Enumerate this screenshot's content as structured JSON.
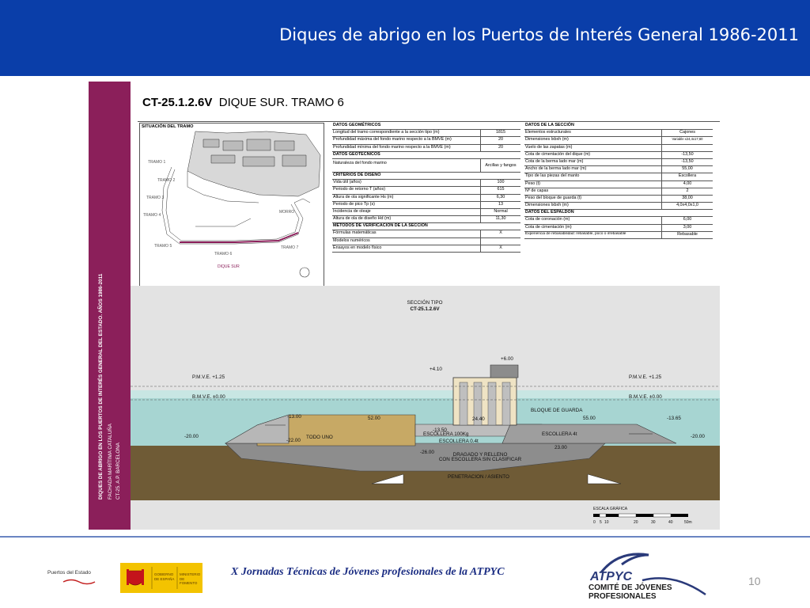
{
  "header": {
    "title": "Diques de abrigo en los Puertos de Interés General  1986-2011"
  },
  "sheet": {
    "code": "CT-25.1.2.6V",
    "name": "DIQUE SUR. TRAMO 6",
    "band_lines": [
      "DIQUES DE ABRIGO EN LOS PUERTOS DE INTERÉS GENERAL DEL ESTADO. AÑOS 1986-2011",
      "FACHADA MARÍTIMA CATALUÑA",
      "CT-25. A.P. BARCELONA"
    ],
    "situacion": {
      "title": "SITUACIÓN DEL TRAMO",
      "labels": [
        "TRAMO 1",
        "TRAMO 2",
        "TRAMO 3",
        "TRAMO 4",
        "TRAMO 5",
        "TRAMO 6",
        "TRAMO 7",
        "MORRO",
        "DIQUE SUR"
      ]
    },
    "geo": {
      "title": "DATOS GEOMÉTRICOS",
      "rows": [
        {
          "k": "Longitud del tramo correspondiente a la sección tipo (m)",
          "v": "1815"
        },
        {
          "k": "Profundidad máxima del fondo marino respecto a la BMVE (m)",
          "v": "20"
        },
        {
          "k": "Profundidad mínima del fondo marino respecto a la BMVE (m)",
          "v": "20"
        }
      ]
    },
    "geotec": {
      "title": "DATOS GEOTÉCNICOS",
      "rows": [
        {
          "k": "Naturaleza del fondo marino",
          "v": "Arcillas y fangos"
        }
      ]
    },
    "criterios": {
      "title": "CRITERIOS DE DISEÑO",
      "rows": [
        {
          "k": "Vida útil (años)",
          "v": "100"
        },
        {
          "k": "Periodo de retorno T (años)",
          "v": "615"
        },
        {
          "k": "Altura de ola significante Hs (m)",
          "v": "6,30"
        },
        {
          "k": "Periodo de pico Tp (s)",
          "v": "13"
        },
        {
          "k": "Incidencia de oleaje",
          "v": "Normal"
        },
        {
          "k": "Altura de ola de diseño Hd (m)",
          "v": "11,30"
        }
      ]
    },
    "metodos": {
      "title": "MÉTODOS DE VERIFICACIÓN DE LA SECCIÓN",
      "rows": [
        {
          "k": "Fórmulas matemáticas",
          "v": "X"
        },
        {
          "k": "Modelos numéricos",
          "v": ""
        },
        {
          "k": "Ensayos en modelo físico",
          "v": "X"
        }
      ]
    },
    "seccion": {
      "title": "DATOS DE LA SECCIÓN",
      "rows": [
        {
          "k": "Elementos estructurales",
          "v": "Cajones"
        },
        {
          "k": "Dimensiones lxbxh (m)",
          "v": "Variable x24,4x17,60"
        },
        {
          "k": "Vuelo de las zapatas (m)",
          "v": ""
        },
        {
          "k": "Cota de cimentación del dique (m)",
          "v": "-13,50"
        },
        {
          "k": "Cota de la berma lado mar (m)",
          "v": "-13,50"
        },
        {
          "k": "Ancho de la berma lado mar (m)",
          "v": "55,00"
        },
        {
          "k": "Tipo de las piezas del manto",
          "v": "Escollera"
        },
        {
          "k": "Peso (t)",
          "v": "4,00"
        },
        {
          "k": "Nº de capas",
          "v": "2"
        },
        {
          "k": "Peso del bloque de guarda (t)",
          "v": "38,00"
        },
        {
          "k": "Dimensiones lxbxh (m)",
          "v": "4,0x4,0x1,0"
        }
      ]
    },
    "espaldon": {
      "title": "DATOS DEL ESPALDÓN",
      "rows": [
        {
          "k": "Cota de coronación (m)",
          "v": "6,00"
        },
        {
          "k": "Cota de cimentación (m)",
          "v": "3,00"
        },
        {
          "k": "Experiencia de rebasabilidad: rebasable, poco o irrebasable",
          "v": "Rebasable"
        }
      ]
    },
    "section_drawing": {
      "title1": "SECCIÓN TIPO",
      "title2": "CT-25.1.2.6V",
      "pmve": "P.M.V.E. +1.25",
      "bmve": "B.M.V.E. ±0.00",
      "labels": {
        "todo_uno": "TODO UNO",
        "escollera_100": "ESCOLLERA 100Kg",
        "escollera_04": "ESCOLLERA 0.4t",
        "escollera_4t": "ESCOLLERA 4t",
        "bloque": "BLOQUE DE GUARDA",
        "dragado1": "DRAGADO Y RELLENO",
        "dragado2": "CON ESCOLLERA SIN CLASIFICAR",
        "penetracion": "PENETRACION / ASIENTO"
      },
      "levels": {
        "plus600": "+6.00",
        "plus410": "+4.10",
        "m1300": "-13.00",
        "m2200": "-22.00",
        "m2000l": "-20.00",
        "m2000r": "-20.00",
        "m1350": "-13.50",
        "m1365": "-13.65",
        "m2600": "-26.00",
        "m2300": "23.00",
        "d5200": "52.00",
        "d2440": "24.40",
        "d5500": "55.00"
      },
      "scale_title": "ESCALA GRÁFICA",
      "scale_ticks": [
        "0",
        "5",
        "10",
        "20",
        "30",
        "40",
        "50m"
      ]
    }
  },
  "footer": {
    "text": "X Jornadas Técnicas de  Jóvenes profesionales de la ATPYC",
    "page": "10",
    "logo_pe": "Puertos del Estado",
    "logo_gov1": "GOBIERNO DE ESPAÑA",
    "logo_gov2": "MINISTERIO DE FOMENTO",
    "atpyc": "ATPYC",
    "atpyc_sub1": "COMITÉ DE JÓVENES",
    "atpyc_sub2": "PROFESIONALES"
  },
  "colors": {
    "header": "#0a3ea9",
    "band": "#8b1f5a",
    "water": "#a7d5d2",
    "sand": "#c7a965",
    "seabed": "#6f5b36",
    "footer_text": "#1b2d83"
  }
}
